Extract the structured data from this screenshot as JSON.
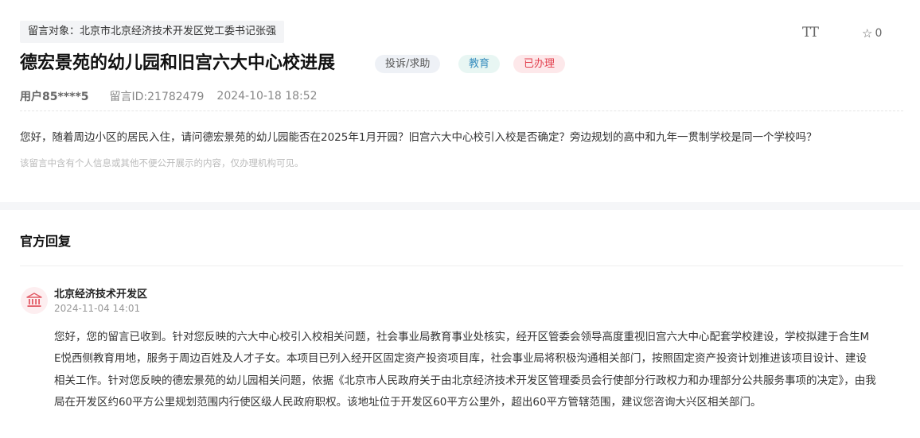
{
  "message": {
    "target_label": "留言对象：北京市北京经济技术开发区党工委书记张强",
    "title": "德宏景苑的幼儿园和旧宫六大中心校进展",
    "badges": {
      "category": "投诉/求助",
      "topic": "教育",
      "status": "已办理"
    },
    "user": "用户85****5",
    "message_id": "留言ID:21782479",
    "datetime": "2024-10-18 18:52",
    "content": "您好，随着周边小区的居民入住，请问德宏景苑的幼儿园能否在2025年1月开园？旧宫六大中心校引入校是否确定？旁边规划的高中和九年一贯制学校是同一个学校吗？",
    "privacy_note": "该留言中含有个人信息或其他不便公开展示的内容，仅办理机构可见。"
  },
  "toolbar": {
    "font_size_icon": "TT",
    "favorite_count": "0"
  },
  "reply": {
    "heading": "官方回复",
    "org_name": "北京经济技术开发区",
    "datetime": "2024-11-04 14:01",
    "lines": [
      "您好，您的留言已收到。针对您反映的六大中心校引入校相关问题，社会事业局教育事业处核实，经开区管委会领导高度重视旧宫六大中心配套学校建设，学校拟建于合生M",
      "E悦西侧教育用地，服务于周边百姓及人才子女。本项目已列入经开区固定资产投资项目库，社会事业局将积极沟通相关部门，按照固定资产投资计划推进该项目设计、建设",
      "相关工作。针对您反映的德宏景苑的幼儿园相关问题，依据《北京市人民政府关于由北京经济技术开发区管理委员会行使部分行政权力和办理部分公共服务事项的决定》，由我",
      "局在开发区约60平方公里规划范围内行使区级人民政府职权。该地址位于开发区60平方公里外，超出60平方管辖范围，建议您咨询大兴区相关部门。"
    ]
  },
  "colors": {
    "status_red": "#e2414f",
    "topic_blue": "#3a8fbf",
    "avatar_bg": "#fdeef0",
    "avatar_icon": "#e25b66"
  }
}
